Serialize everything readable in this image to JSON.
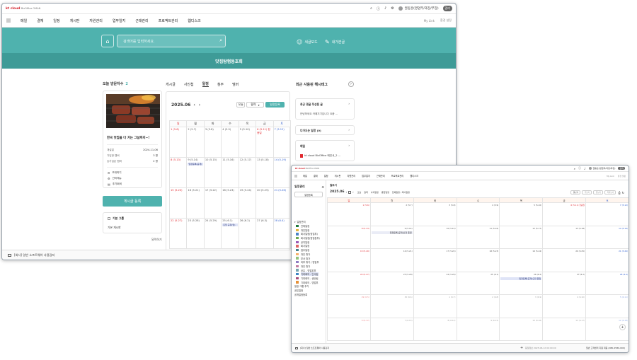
{
  "main_window": {
    "logo_brand": "kt cloud",
    "logo_product": "BizOffice OMAN",
    "user": "권동훈(영업부/과장/부장)",
    "user_badge": "관리",
    "menu": [
      "메일",
      "결재",
      "일정",
      "게시판",
      "자원관리",
      "업무일지",
      "근태관리",
      "프로젝트관리",
      "웹디스크"
    ],
    "my_links": "My Link",
    "env_settings": "환경 설정",
    "search_placeholder": "검색어를 입력하세요.",
    "new_password": "새글모드",
    "my_info": "내가본글",
    "community_name": "맛집탐험동호회",
    "visitors_label": "오늘 방문자수",
    "visitors_count": "2",
    "post_title": "한국 맛집을 다 가는 그날까지~!",
    "info": [
      {
        "k": "개설일",
        "v": "2024-11-06"
      },
      {
        "k": "가입한 멤버",
        "v": "3 명"
      },
      {
        "k": "승가입은 멤버",
        "v": "2 명"
      }
    ],
    "links": [
      "초대하기",
      "관리메뉴",
      "추가회비"
    ],
    "write_btn": "게시글 등록",
    "group_head": "기본 그룹",
    "group_item": "기본 게시판",
    "tabs": [
      "게시글",
      "사진첩",
      "일정",
      "첨부",
      "멤버"
    ],
    "month": "2025.06",
    "cal_btns": {
      "today": "오늘",
      "view": "월력",
      "add": "일정등록"
    },
    "weekdays": [
      "일",
      "월",
      "화",
      "수",
      "목",
      "금",
      "토"
    ],
    "weeks": [
      [
        "1 (5.6)",
        "2 (5.7)",
        "3 (5.8)",
        "4 (5.9)",
        "5 (5.10)",
        "6 (5.11) 현충일",
        "7 (5.12)"
      ],
      [
        "8 (5.13)",
        "9 (5.14)",
        "10 (5.15)",
        "11 (5.16)",
        "12 (5.17)",
        "13 (5.18)",
        "14 (5.19)"
      ],
      [
        "15 (5.20)",
        "16 (5.21)",
        "17 (5.22)",
        "18 (5.23)",
        "19 (5.24)",
        "20 (5.25)",
        "21 (5.26)"
      ],
      [
        "22 (5.27)",
        "23 (5.28)",
        "24 (5.29)",
        "25 (6.1)",
        "26 (6.2)",
        "27 (6.3)",
        "28 (6.4)"
      ]
    ],
    "event_week2": "일정등록(공개)",
    "event_week4": "모임 공유(월)",
    "hashtag_title": "최근 사용된 해시태그",
    "side_items": [
      {
        "t": "최근 댓글 작성된 글",
        "s": "안녕하세요 카페지기입니다 요즘 ..."
      },
      {
        "t": "다가오는 일정 (0)",
        "s": ""
      },
      {
        "t": "메일",
        "s": "kt cloud BizOffice 메인서_2 ..."
      }
    ],
    "more_link": "달력하기",
    "bottom_text": "[회사] 일반 소프트웨어 사용감지"
  },
  "second_window": {
    "logo_brand": "kt cloud",
    "logo_product": "BizOffice OMAN",
    "user": "권동훈(영업부/과장/부장)",
    "user_badge": "관리",
    "menu": [
      "메일",
      "결재",
      "일정",
      "게시판",
      "자원관리",
      "업무일지",
      "근태관리",
      "프로젝트관리",
      "웹디스크"
    ],
    "my_links": "My Link",
    "env_settings": "환경 설정",
    "side_title": "일정관리",
    "side_btn": "일정등록",
    "tree_root": "일정관리",
    "tree": [
      {
        "n": "전체일정",
        "c": "#1f7a3b"
      },
      {
        "n": "개인일정",
        "c": "#e7b53b"
      },
      {
        "n": "회사일정(영업부)",
        "c": "#4d84c8"
      },
      {
        "n": "회사일정(영업본부)",
        "c": "#6aa84f"
      },
      {
        "n": "공지일정",
        "c": "#9b59b6"
      },
      {
        "n": "회사일정",
        "c": "#e06666"
      },
      {
        "n": "업무일정",
        "c": "#45818e"
      },
      {
        "n": "개인 휴가",
        "c": "#f6b26b"
      },
      {
        "n": "부서 휴가",
        "c": "#93c47d"
      },
      {
        "n": "외부 휴가 / 영업부",
        "c": "#8e7cc3"
      },
      {
        "n": "개인 휴가",
        "c": "#c27ba0"
      },
      {
        "n": "공유 - 영업본부",
        "c": "#76a5af"
      },
      {
        "n": "기획회의 - 인사팀",
        "c": "#3d85c6"
      },
      {
        "n": "기획회의 - 생산팀",
        "c": "#a64d79"
      },
      {
        "n": "기획회의 - 영업부",
        "c": "#e69138"
      }
    ],
    "tree_extra": [
      "일정 그룹 추가",
      "공유일정",
      "공개일정등록"
    ],
    "cal_title": "월보기",
    "month": "2025.06",
    "toolbar": [
      "오늘",
      "월력",
      "나의일정",
      "종합일정",
      "전체일정 / 회사일정"
    ],
    "view_tabs": [
      "월보기",
      "주보기",
      "일보기",
      "목록보기"
    ],
    "weekdays": [
      "일",
      "월",
      "화",
      "수",
      "목",
      "금",
      "토"
    ],
    "weeks": [
      [
        "1 (5.6)",
        "2 (5.7)",
        "3 (5.8)",
        "4 (5.9)",
        "5 (5.10)",
        "6 (5.11) 현충일",
        "7 (5.12)"
      ],
      [
        "8 (5.13)",
        "9 (5.14)",
        "10 (5.15)",
        "11 (5.16)",
        "12 (5.17)",
        "13 (5.18)",
        "14 (5.19)"
      ],
      [
        "15 (5.20)",
        "16 (5.21)",
        "17 (5.22)",
        "18 (5.23)",
        "19 (5.24)",
        "20 (5.25)",
        "21 (5.26)"
      ],
      [
        "22 (5.27)",
        "23 (5.28)",
        "24 (5.29)",
        "25 (6.1)",
        "26 (6.2)",
        "27 (6.3)",
        "28 (6.4)"
      ],
      [
        "29 (6.5)",
        "30 (6.6)",
        "1 (6.7)",
        "2 (6.8)",
        "3 (6.9)",
        "4 (6.10)",
        "5 (6.11)"
      ],
      [
        "6 (6.12)",
        "7 (6.13)",
        "8 (6.14)",
        "9 (6.15)",
        "10 (6.16)",
        "11 (6.17)",
        "12 (6.18)"
      ]
    ],
    "event_w2": "일정등록(공개)오전 종일",
    "event_w4": "일정등록(공개)오전 종일",
    "bottom_text": "[회사] 일반 소프트웨어 사용감지",
    "bottom_mid": "동일정보 2025.06.12 00:00:00",
    "bottom_right": "일반 고객센터 지원 대응 (080-2580-000)"
  }
}
